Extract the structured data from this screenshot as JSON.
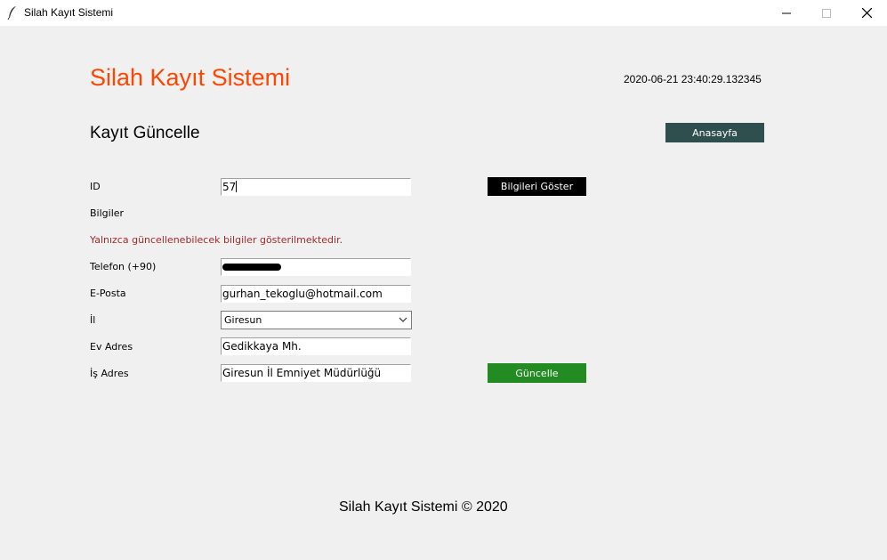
{
  "window": {
    "title": "Silah Kayıt Sistemi",
    "icon": "feather-icon"
  },
  "header": {
    "app_title": "Silah Kayıt Sistemi",
    "timestamp": "2020-06-21 23:40:29.132345"
  },
  "page": {
    "title": "Kayıt Güncelle",
    "home_button": "Anasayfa"
  },
  "form": {
    "id_label": "ID",
    "id_value": "57",
    "show_button": "Bilgileri Göster",
    "info_label": "Bilgiler",
    "notice": "Yalnızca güncellenebilecek bilgiler gösterilmektedir.",
    "phone_label": "Telefon (+90)",
    "phone_value": "",
    "email_label": "E-Posta",
    "email_value": "gurhan_tekoglu@hotmail.com",
    "city_label": "İl",
    "city_value": "Giresun",
    "home_address_label": "Ev Adres",
    "home_address_value": "Gedikkaya Mh.",
    "work_address_label": "İş Adres",
    "work_address_value": "Giresun İl Emniyet Müdürlüğü",
    "update_button": "Güncelle"
  },
  "footer": {
    "text": "Silah Kayıt Sistemi © 2020"
  },
  "colors": {
    "title_orange": "#ff4500",
    "home_button_bg": "#2f4f4f",
    "show_button_bg": "#000000",
    "update_button_bg": "#228b22",
    "notice_color": "#a52a2a",
    "background": "#f0f0f0"
  }
}
